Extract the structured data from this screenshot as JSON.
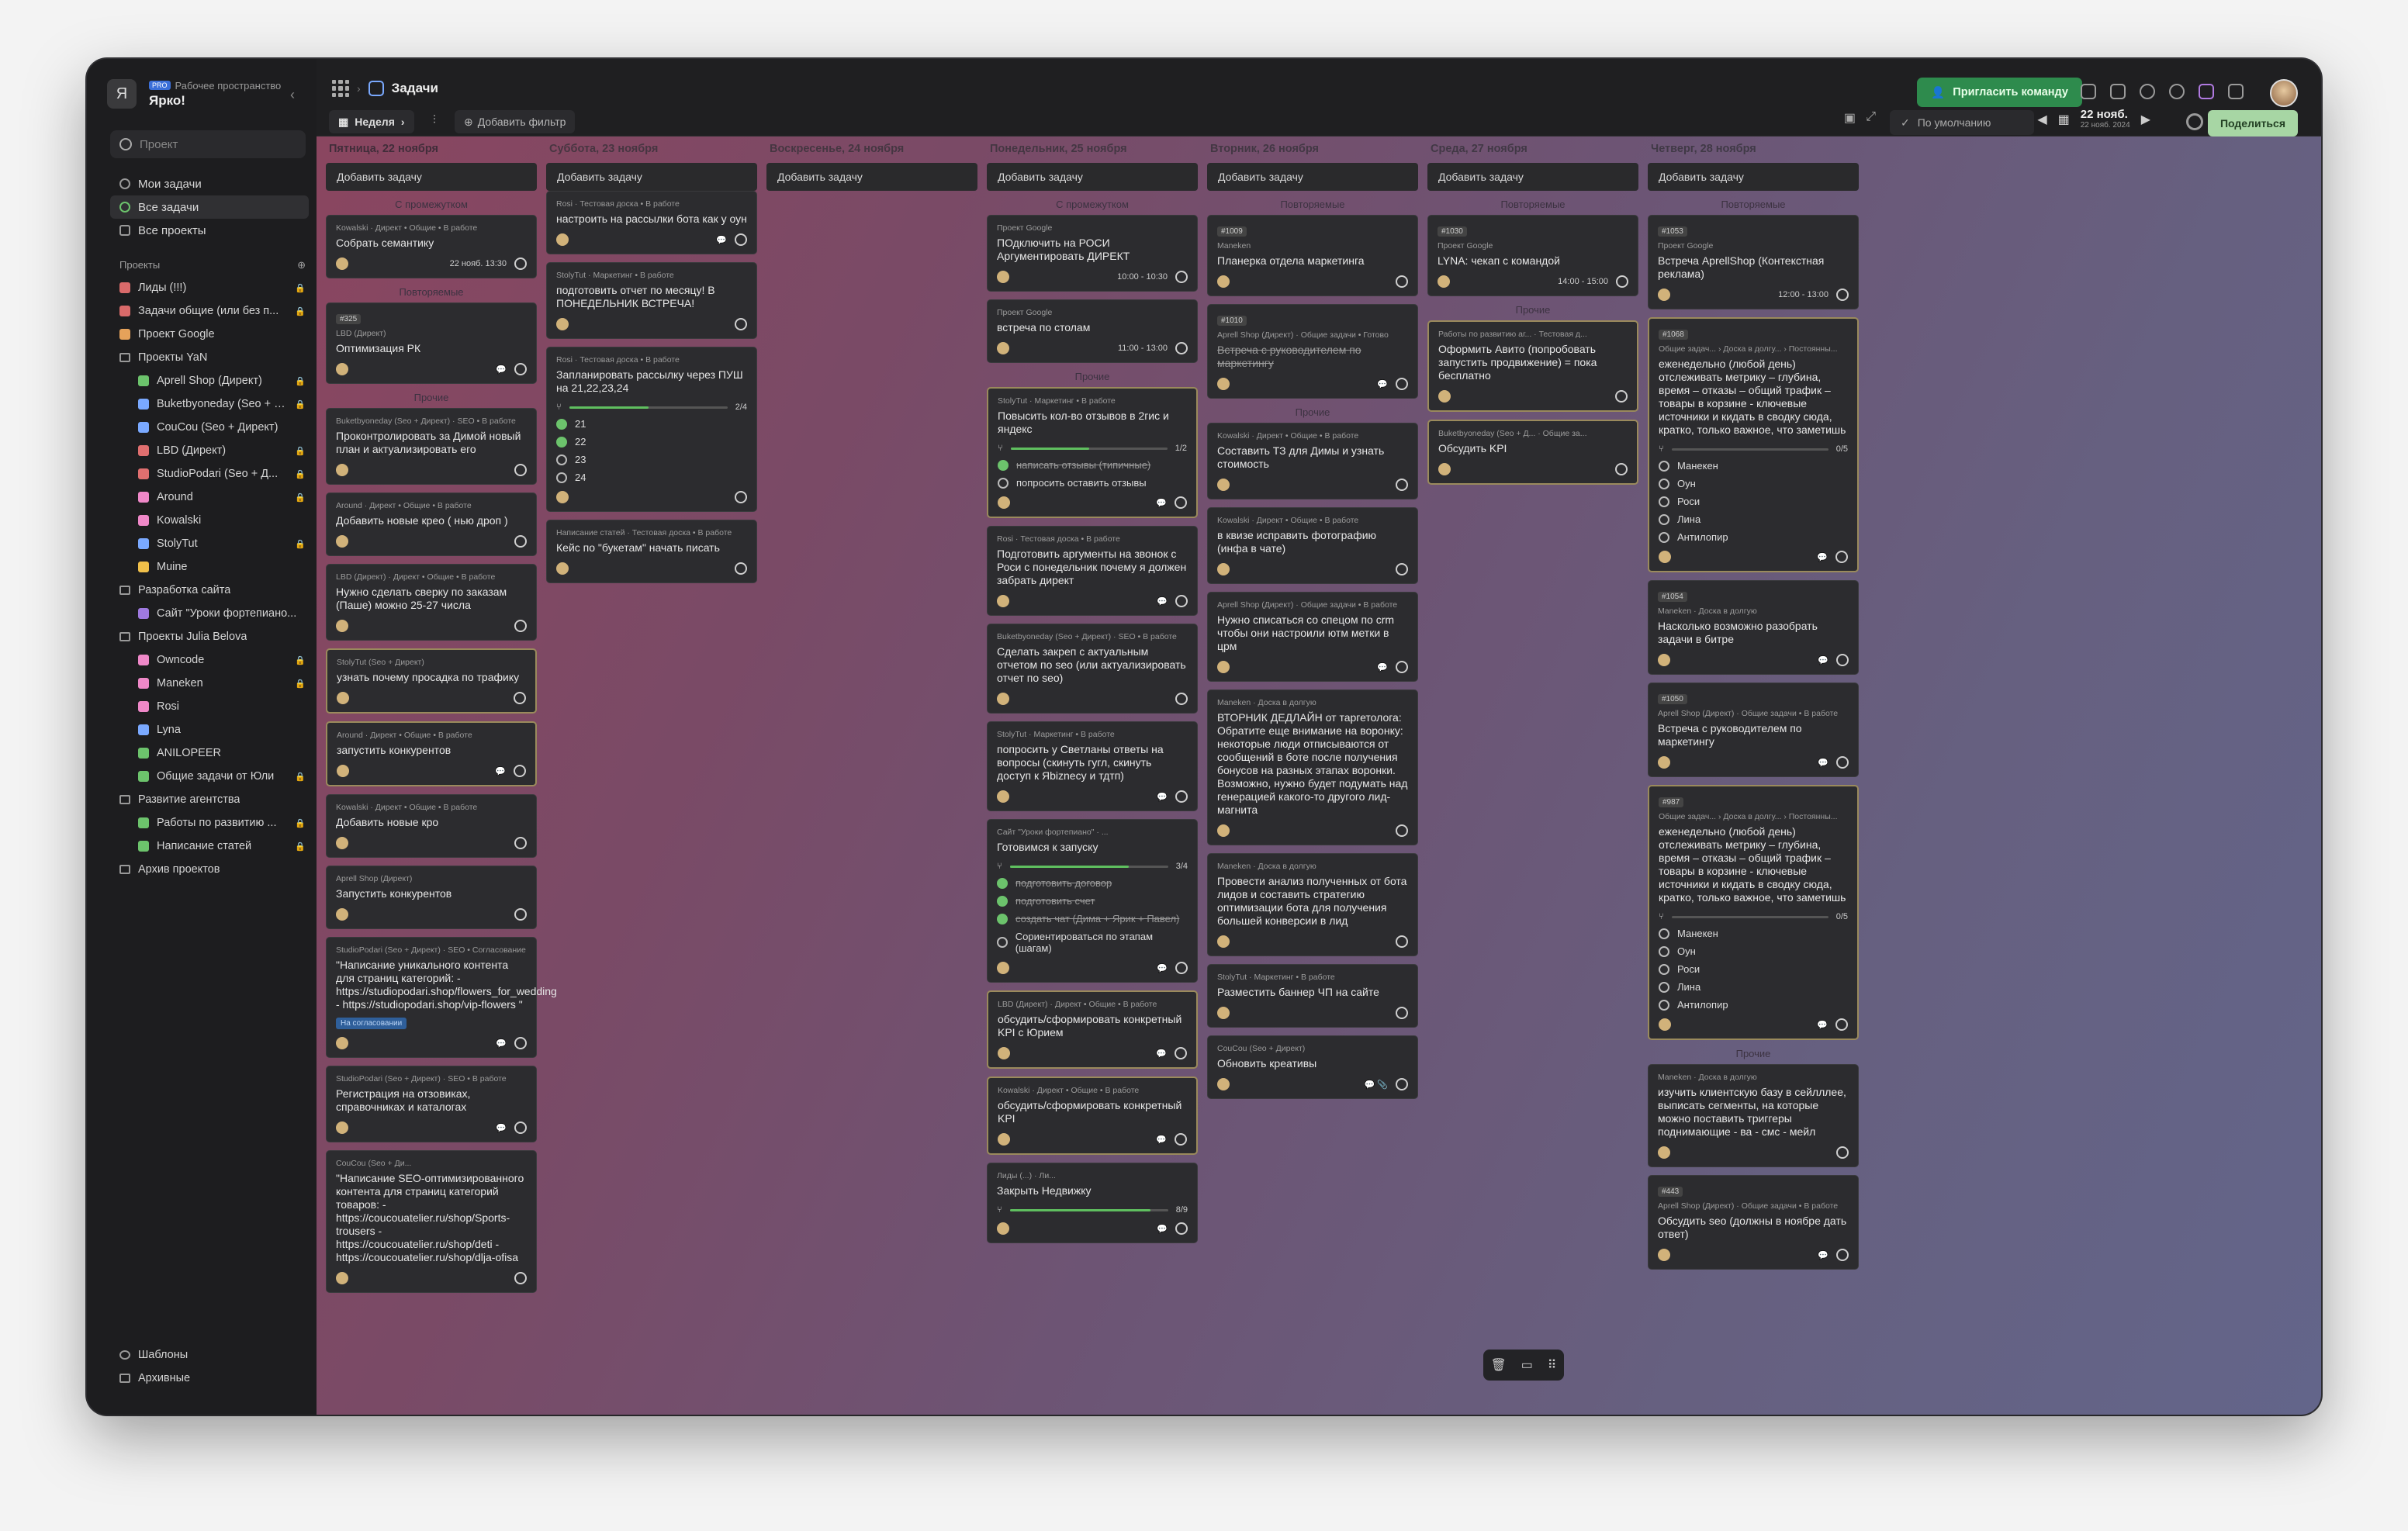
{
  "workspace": {
    "avatar": "Я",
    "subtitle": "Рабочее пространство",
    "badge": "PRO",
    "name": "Ярко!"
  },
  "search": {
    "placeholder": "Проект"
  },
  "nav": [
    {
      "label": "Мои задачи"
    },
    {
      "label": "Все задачи"
    },
    {
      "label": "Все проекты"
    }
  ],
  "projects_header": "Проекты",
  "projects": [
    {
      "label": "Лиды (!!!)",
      "color": "#d96a6a",
      "lock": true,
      "sub": false
    },
    {
      "label": "Задачи общие (или без п...",
      "color": "#d96a6a",
      "lock": true,
      "sub": false
    },
    {
      "label": "Проект Google",
      "color": "#e6a25a",
      "lock": false,
      "sub": false
    },
    {
      "label": "Проекты YaN",
      "folder": true,
      "sub": false
    },
    {
      "label": "Aprell Shop (Директ)",
      "color": "#6cc36c",
      "lock": true,
      "sub": true
    },
    {
      "label": "Buketbyoneday (Seo + Ди...",
      "color": "#7aa9ff",
      "lock": true,
      "sub": true
    },
    {
      "label": "CouCou (Seo + Директ)",
      "color": "#7aa9ff",
      "lock": false,
      "sub": true
    },
    {
      "label": "LBD (Директ)",
      "color": "#e06f6f",
      "lock": true,
      "sub": true
    },
    {
      "label": "StudioPodari (Seo + Д...",
      "color": "#e06f6f",
      "lock": true,
      "sub": true
    },
    {
      "label": "Around",
      "color": "#ef88c8",
      "lock": true,
      "sub": true
    },
    {
      "label": "Kowalski",
      "color": "#ef88c8",
      "lock": false,
      "sub": true
    },
    {
      "label": "StolyTut",
      "color": "#7aa9ff",
      "lock": true,
      "sub": true
    },
    {
      "label": "Muine",
      "color": "#f0c04a",
      "lock": false,
      "sub": true
    },
    {
      "label": "Разработка сайта",
      "folder": true,
      "sub": false
    },
    {
      "label": "Сайт \"Уроки фортепиано...",
      "color": "#9f7ae0",
      "lock": false,
      "sub": true
    },
    {
      "label": "Проекты Julia Belova",
      "folder": true,
      "sub": false
    },
    {
      "label": "Owncode",
      "color": "#ef88c8",
      "lock": true,
      "sub": true
    },
    {
      "label": "Maneken",
      "color": "#ef88c8",
      "lock": true,
      "sub": true
    },
    {
      "label": "Rosi",
      "color": "#ef88c8",
      "lock": false,
      "sub": true
    },
    {
      "label": "Lyna",
      "color": "#7aa9ff",
      "lock": false,
      "sub": true
    },
    {
      "label": "ANILOPEER",
      "color": "#6cc36c",
      "lock": false,
      "sub": true
    },
    {
      "label": "Общие задачи от Юли",
      "color": "#6cc36c",
      "lock": true,
      "sub": true
    },
    {
      "label": "Развитие агентства",
      "folder": true,
      "sub": false
    },
    {
      "label": "Работы по развитию ...",
      "color": "#6cc36c",
      "lock": true,
      "sub": true
    },
    {
      "label": "Написание статей",
      "color": "#6cc36c",
      "lock": true,
      "sub": true
    },
    {
      "label": "Архив проектов",
      "folder": true,
      "sub": false
    }
  ],
  "sidebar_bottom": [
    {
      "label": "Шаблоны"
    },
    {
      "label": "Архивные"
    }
  ],
  "topbar": {
    "page_title": "Задачи",
    "invite": "Пригласить команду",
    "week": "Неделя",
    "add_filter": "Добавить фильтр",
    "default": "По умолчанию",
    "date": "22 нояб.",
    "date_sub": "22 нояб. 2024",
    "share": "Поделиться"
  },
  "add_task": "Добавить задачу",
  "columns": [
    {
      "header": "Пятница, 22 ноября",
      "groups": [
        {
          "label": "С промежутком",
          "cards": [
            {
              "proj": "Kowalski · Директ • Общие • В работе",
              "title": "Собрать семантику",
              "time": "22 нояб. 13:30"
            }
          ]
        },
        {
          "label": "Повторяемые",
          "cards": [
            {
              "id": "#325",
              "proj": "LBD (Директ)",
              "title": "Оптимизация РК",
              "cmt": "💬"
            }
          ]
        },
        {
          "label": "Прочие",
          "cards": [
            {
              "proj": "Buketbyoneday (Seo + Директ) · SEO • В работе",
              "title": "Проконтролировать за Димой новый план и актуализировать его"
            },
            {
              "proj": "Around · Директ • Общие • В работе",
              "title": "Добавить новые крео ( нью дроп )"
            },
            {
              "proj": "LBD (Директ) · Директ • Общие • В работе",
              "title": "Нужно сделать сверку по заказам (Паше) можно 25-27 числа"
            },
            {
              "proj": "StolyTut (Seo + Директ)",
              "title": "узнать почему просадка по трафику",
              "hl": true
            },
            {
              "proj": "Around · Директ • Общие • В работе",
              "title": "запустить конкурентов",
              "cmt": "💬",
              "hl": true
            },
            {
              "proj": "Kowalski · Директ • Общие • В работе",
              "title": "Добавить новые кро"
            },
            {
              "proj": "Aprell Shop (Директ)",
              "title": "Запустить конкурентов"
            },
            {
              "proj": "StudioPodari (Seo + Директ) · SEO • Согласование",
              "title": "\"Написание уникального контента для страниц категорий: - https://studiopodari.shop/flowers_for_wedding - https://studiopodari.shop/vip-flowers \"",
              "cmt": "💬",
              "tag": "На согласовании"
            },
            {
              "proj": "StudioPodari (Seo + Директ) · SEO • В работе",
              "title": "Регистрация на отзовиках, справочниках и каталогах",
              "cmt": "💬"
            },
            {
              "proj": "CouCou (Seo + Ди...",
              "title": "\"Написание SEO-оптимизированного контента для страниц категорий товаров: - https://coucouatelier.ru/shop/Sports-trousers - https://coucouatelier.ru/shop/deti - https://coucouatelier.ru/shop/dlja-ofisa"
            }
          ]
        }
      ]
    },
    {
      "header": "Суббота, 23 ноября",
      "groups": [
        {
          "label": "",
          "cards": [
            {
              "proj": "Rosi · Тестовая доска • В работе",
              "title": "настроить на рассылки бота как у оун",
              "cmt": "💬"
            },
            {
              "proj": "StolyTut · Маркетинг • В работе",
              "title": "подготовить отчет по месяцу! В ПОНЕДЕЛЬНИК ВСТРЕЧА!"
            },
            {
              "proj": "Rosi · Тестовая доска • В работе",
              "title": "Запланировать рассылку через ПУШ на 21,22,23,24",
              "progress": {
                "label": "2/4",
                "pct": 50
              },
              "subs": [
                {
                  "t": "21",
                  "on": true
                },
                {
                  "t": "22",
                  "on": true
                },
                {
                  "t": "23",
                  "on": false
                },
                {
                  "t": "24",
                  "on": false
                }
              ]
            },
            {
              "proj": "Написание статей · Тестовая доска • В работе",
              "title": "Кейс по \"букетам\" начать писать"
            }
          ]
        }
      ]
    },
    {
      "header": "Воскресенье, 24 ноября",
      "groups": []
    },
    {
      "header": "Понедельник, 25 ноября",
      "groups": [
        {
          "label": "С промежутком",
          "cards": [
            {
              "proj": "Проект Google",
              "title": "ПОдключить на РОСИ Аргументировать ДИРЕКТ",
              "time": "10:00 - 10:30"
            },
            {
              "proj": "Проект Google",
              "title": "встреча по столам",
              "time": "11:00 - 13:00"
            }
          ]
        },
        {
          "label": "Прочие",
          "cards": [
            {
              "proj": "StolyTut · Маркетинг • В работе",
              "title": "Повысить кол-во отзывов в 2гис и яндекс",
              "cmt": "💬",
              "hl": true,
              "progress": {
                "label": "1/2",
                "pct": 50
              },
              "subs": [
                {
                  "t": "написать отзывы (типичные)",
                  "on": true,
                  "done": true
                },
                {
                  "t": "попросить оставить отзывы",
                  "on": false
                }
              ]
            },
            {
              "proj": "Rosi · Тестовая доска • В работе",
              "title": "Подготовить аргументы на звонок с Роси с понедельник почему я должен забрать директ",
              "cmt": "💬"
            },
            {
              "proj": "Buketbyoneday (Seo + Директ) · SEO • В работе",
              "title": "Сделать закреп с актуальным отчетом по seo (или актуализировать отчет по seo)"
            },
            {
              "proj": "StolyTut · Маркетинг • В работе",
              "title": "попросить у Светланы ответы на вопросы (скинуть гугл, скинуть доступ к Яbiznecy и тдтп)",
              "cmt": "💬"
            },
            {
              "proj": "Сайт \"Уроки фортепиано\" · ...",
              "title": "Готовимся к запуску",
              "cmt": "💬",
              "progress": {
                "label": "3/4",
                "pct": 75
              },
              "subs": [
                {
                  "t": "подготовить договор",
                  "on": true,
                  "done": true
                },
                {
                  "t": "подготовить счет",
                  "on": true,
                  "done": true
                },
                {
                  "t": "создать чат (Дима + Ярик + Павел)",
                  "on": true,
                  "done": true
                },
                {
                  "t": "Сориентироваться по этапам (шагам)",
                  "on": false
                }
              ]
            },
            {
              "proj": "LBD (Директ) · Директ • Общие • В работе",
              "title": "обсудить/сформировать конкретный KPI с Юрием",
              "cmt": "💬",
              "hl": true
            },
            {
              "proj": "Kowalski · Директ • Общие • В работе",
              "title": "обсудить/сформировать конкретный KPI",
              "cmt": "💬",
              "hl": true
            },
            {
              "proj": "Лиды (...) · Ли...",
              "title": "Закрыть Недвижку",
              "cmt": "💬",
              "progress": {
                "label": "8/9",
                "pct": 89
              }
            }
          ]
        }
      ]
    },
    {
      "header": "Вторник, 26 ноября",
      "groups": [
        {
          "label": "Повторяемые",
          "cards": [
            {
              "id": "#1009",
              "proj": "Maneken",
              "title": "Планерка отдела маркетинга"
            },
            {
              "id": "#1010",
              "proj": "Aprell Shop (Директ) · Общие задачи • Готово",
              "title": "Встреча с руководителем по маркетингу",
              "done": true,
              "cmt": "💬"
            }
          ]
        },
        {
          "label": "Прочие",
          "cards": [
            {
              "proj": "Kowalski · Директ • Общие • В работе",
              "title": "Составить ТЗ для Димы и узнать стоимость"
            },
            {
              "proj": "Kowalski · Директ • Общие • В работе",
              "title": "в квизе исправить фотографию (инфа в чате)"
            },
            {
              "proj": "Aprell Shop (Директ) · Общие задачи • В работе",
              "title": "Нужно списаться со спецом по crm чтобы они настроили ютм метки в црм",
              "cmt": "💬"
            },
            {
              "proj": "Maneken · Доска в долгую",
              "title": "ВТОРНИК ДЕДЛАЙН от таргетолога: Обратите еще внимание на воронку: некоторые люди отписываются от сообщений в боте после получения бонусов на разных этапах воронки. Возможно, нужно будет подумать над генерацией какого-то другого лид-магнита"
            },
            {
              "proj": "Maneken · Доска в долгую",
              "title": "Провести анализ полученных от бота лидов и составить стратегию оптимизации бота для получения большей конверсии в лид"
            },
            {
              "proj": "StolyTut · Маркетинг • В работе",
              "title": "Разместить баннер ЧП на сайте"
            },
            {
              "proj": "CouCou (Seo + Директ)",
              "title": "Обновить креативы",
              "cmt": "💬 📎"
            }
          ]
        }
      ]
    },
    {
      "header": "Среда, 27 ноября",
      "groups": [
        {
          "label": "Повторяемые",
          "cards": [
            {
              "id": "#1030",
              "proj": "Проект Google",
              "title": "LYNA: чекап с командой",
              "time": "14:00 - 15:00"
            }
          ]
        },
        {
          "label": "Прочие",
          "cards": [
            {
              "proj": "Работы по развитию аг... · Тестовая д...",
              "title": "Оформить Авито (попробовать запустить продвижение) = пока бесплатно",
              "hl": true
            },
            {
              "proj": "Buketbyoneday (Seo + Д... · Общие за...",
              "title": "Обсудить KPI",
              "hl": true
            }
          ]
        }
      ]
    },
    {
      "header": "Четверг, 28 ноября",
      "groups": [
        {
          "label": "Повторяемые",
          "cards": [
            {
              "id": "#1053",
              "proj": "Проект Google",
              "title": "Встреча AprellShop (Контекстная реклама)",
              "time": "12:00 - 13:00"
            },
            {
              "id": "#1068",
              "proj": "Общие задач... › Доска в долгу... › Постоянны...",
              "title": "еженедельно (любой день) отслеживать метрику – глубина, время – отказы – общий трафик – товары в корзине - ключевые источники и кидать в сводку сюда, кратко, только важное, что заметишь",
              "hl": true,
              "cmt": "💬",
              "progress": {
                "label": "0/5",
                "pct": 0
              },
              "subs": [
                {
                  "t": "Манекен",
                  "on": false
                },
                {
                  "t": "Оун",
                  "on": false
                },
                {
                  "t": "Роси",
                  "on": false
                },
                {
                  "t": "Лина",
                  "on": false
                },
                {
                  "t": "Антилопир",
                  "on": false
                }
              ]
            },
            {
              "id": "#1054",
              "proj": "Maneken · Доска в долгую",
              "title": "Насколько возможно разобрать задачи в битре",
              "cmt": "💬"
            },
            {
              "id": "#1050",
              "proj": "Aprell Shop (Директ) · Общие задачи • В работе",
              "title": "Встреча с руководителем по маркетингу",
              "cmt": "💬"
            },
            {
              "id": "#987",
              "proj": "Общие задач... › Доска в долгу... › Постоянны...",
              "title": "еженедельно (любой день) отслеживать метрику – глубина, время – отказы – общий трафик – товары в корзине - ключевые источники и кидать в сводку сюда, кратко, только важное, что заметишь",
              "hl": true,
              "cmt": "💬",
              "progress": {
                "label": "0/5",
                "pct": 0
              },
              "subs": [
                {
                  "t": "Манекен",
                  "on": false
                },
                {
                  "t": "Оун",
                  "on": false
                },
                {
                  "t": "Роси",
                  "on": false
                },
                {
                  "t": "Лина",
                  "on": false
                },
                {
                  "t": "Антилопир",
                  "on": false
                }
              ]
            }
          ]
        },
        {
          "label": "Прочие",
          "cards": [
            {
              "proj": "Maneken · Доска в долгую",
              "title": "изучить клиентскую базу в сейлллее, выписать сегменты, на которые можно поставить триггеры поднимающие - ва - смс - мейл"
            },
            {
              "id": "#443",
              "proj": "Aprell Shop (Директ) · Общие задачи • В работе",
              "title": "Обсудить seo (должны в ноябре дать ответ)",
              "cmt": "💬"
            }
          ]
        }
      ]
    }
  ],
  "colors": {
    "accent": "#2e8b4d",
    "share_bg": "#a7d6a4",
    "board_start": "#8a4660",
    "board_end": "#63658a"
  }
}
